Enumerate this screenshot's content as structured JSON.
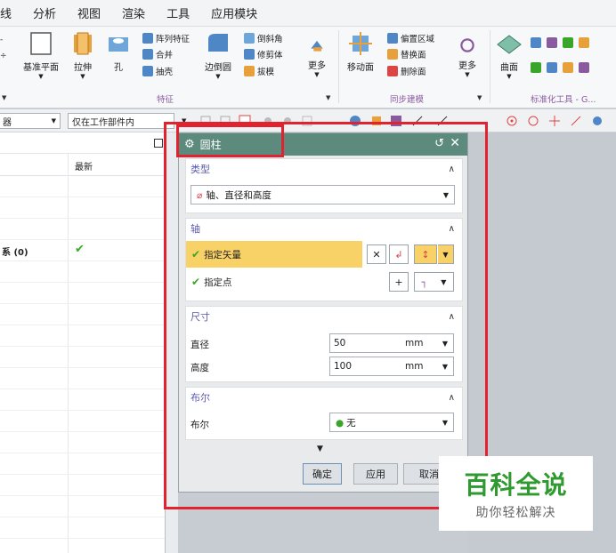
{
  "menu": [
    "线",
    "分析",
    "视图",
    "渲染",
    "工具",
    "应用模块"
  ],
  "ribbon": {
    "buttons": [
      {
        "label": "基准平面",
        "icon": "datum-plane-icon"
      },
      {
        "label": "拉伸",
        "icon": "extrude-icon"
      },
      {
        "label": "孔",
        "icon": "hole-icon"
      },
      {
        "label": "边倒圆",
        "icon": "edge-blend-icon"
      },
      {
        "label": "更多",
        "icon": "more-icon"
      },
      {
        "label": "移动面",
        "icon": "move-face-icon"
      },
      {
        "label": "更多",
        "icon": "more-icon"
      },
      {
        "label": "曲面",
        "icon": "surface-icon"
      }
    ],
    "small_items": [
      "阵列特征",
      "合并",
      "抽壳",
      "倒斜角",
      "修剪体",
      "拔模",
      "偏置区域",
      "替换面",
      "删除面"
    ],
    "groups": [
      "特征",
      "同步建模",
      "标准化工具 - G..."
    ],
    "colors": {
      "accent_purple": "#8a5a9f",
      "icon_blue": "#4f86c6",
      "icon_orange": "#e8a13a"
    }
  },
  "selection_bar": {
    "filter_value": "器",
    "scope_value": "仅在工作部件内"
  },
  "navigator": {
    "column_header": "最新",
    "row_label": "系 (0)",
    "row_status": "✔"
  },
  "dialog": {
    "title": "圆柱",
    "title_bar_color": "#5c8a7c",
    "type_section": {
      "header": "类型",
      "value": "轴、直径和高度"
    },
    "axis_section": {
      "header": "轴",
      "specify_vector": "指定矢量",
      "specify_point": "指定点",
      "highlight_color": "#f9d267"
    },
    "dimension_section": {
      "header": "尺寸",
      "diameter_label": "直径",
      "diameter_value": "50",
      "diameter_unit": "mm",
      "height_label": "高度",
      "height_value": "100",
      "height_unit": "mm"
    },
    "boolean_section": {
      "header": "布尔",
      "label": "布尔",
      "value": "无"
    },
    "buttons": {
      "ok": "确定",
      "apply": "应用",
      "cancel": "取消"
    }
  },
  "watermark": {
    "title": "百科全说",
    "subtitle": "助你轻松解决"
  },
  "highlight_color": "#e2232f"
}
